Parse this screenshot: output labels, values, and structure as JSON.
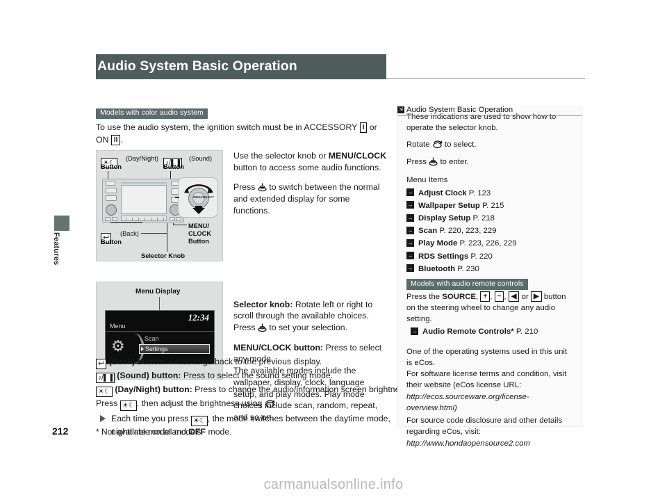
{
  "page": {
    "title": "Audio System Basic Operation",
    "number": "212",
    "footnote": "* Not available on all models",
    "side_tab": "Features",
    "watermark": "carmanualsonline.info"
  },
  "main": {
    "model_chip": "Models with color audio system",
    "intro_prefix": "To use the audio system, the ignition switch must be in ACCESSORY",
    "key_accessory": "I",
    "intro_mid": "or ON",
    "key_on": "II",
    "intro_suffix": ".",
    "para1_a": "Use the selector knob or ",
    "para1_bold": "MENU/CLOCK",
    "para1_b": "button to access some audio functions.",
    "para2_a": "Press",
    "para2_b": "to switch between the normal and extended display for some functions.",
    "selector_knob_label": "Selector knob:",
    "selector_knob_text_a": "Rotate left or right to scroll through the available choices. Press",
    "selector_knob_text_b": "to set your selection.",
    "menuclock_label": "MENU/CLOCK button:",
    "menuclock_text": "Press to select any mode.",
    "modes_text": "The available modes include the wallpaper, display, clock, language setup, and play modes. Play mode choices include scan, random, repeat, and so on."
  },
  "illustration_panel": {
    "daynight_label": "(Day/Night)",
    "daynight_button": "Button",
    "sound_label": "(Sound)",
    "sound_button": "Button",
    "back_label": "(Back)",
    "back_button": "Button",
    "menu_clock_line1": "MENU/",
    "menu_clock_line2": "CLOCK",
    "menu_clock_line3": "Button",
    "selector_knob": "Selector Knob",
    "knob_glyph_text": "MENU/SELECT"
  },
  "illustration_menu": {
    "caption": "Menu Display",
    "clock": "12:34",
    "menu": "Menu",
    "scan": "Scan",
    "settings": "Settings",
    "gear_icon": "gear-icon"
  },
  "buttons": {
    "back": {
      "name": "(Back) button:",
      "desc": "Press to go back to the previous display."
    },
    "sound": {
      "name": "(Sound) button:",
      "desc": "Press to select the sound setting mode."
    },
    "daynight": {
      "name": "(Day/Night) button:",
      "desc": "Press to change the audio/information screen brightness."
    },
    "press_line_a": "Press",
    "press_line_b": ", then adjust the brightness using",
    "press_line_c": ".",
    "bullet_a": "Each time you press",
    "bullet_b": ", the mode switches between the daytime mode, nighttime mode and",
    "bullet_bold": "OFF",
    "bullet_c": "mode."
  },
  "sidebar": {
    "header": "Audio System Basic Operation",
    "header_icon": "section-ref-icon",
    "intro": "These indications are used to show how to operate the selector knob.",
    "rotate_a": "Rotate",
    "rotate_b": "to select.",
    "press_a": "Press",
    "press_b": "to enter.",
    "menu_items_title": "Menu Items",
    "menu_items": [
      {
        "label": "Adjust Clock",
        "page": "P. 123"
      },
      {
        "label": "Wallpaper Setup",
        "page": "P. 215"
      },
      {
        "label": "Display Setup",
        "page": "P. 218"
      },
      {
        "label": "Scan",
        "page": "P. 220, 223, 229"
      },
      {
        "label": "Play Mode",
        "page": "P. 223, 226, 229"
      },
      {
        "label": "RDS Settings",
        "page": "P. 220"
      },
      {
        "label": "Bluetooth",
        "page": "P. 230"
      }
    ],
    "remote_chip": "Models with audio remote controls",
    "remote_a": "Press the",
    "remote_source": "SOURCE",
    "remote_plus": "+",
    "remote_minus": "−",
    "remote_left": "◀",
    "remote_or": "or",
    "remote_right": "▶",
    "remote_b": "button on the steering wheel to change any audio setting.",
    "remote_ref_label": "Audio Remote Controls",
    "remote_ref_star": "*",
    "remote_ref_page": "P. 210",
    "ecos_1": "One of the operating systems used in this unit is eCos.",
    "ecos_2": "For software license terms and condition, visit their website (eCos license URL:",
    "ecos_url1": "http://ecos.sourceware.org/license-overview.html)",
    "ecos_3": "For source code disclosure and other details regarding eCos, visit:",
    "ecos_url2": "http://www.hondaopensource2.com"
  },
  "colors": {
    "header_band": "#4e5c5c",
    "chip": "#5c6b6b",
    "illustration_bg": "#dce1e0",
    "sidebar_bg": "#fafafa",
    "watermark": "#b9b9b9"
  }
}
